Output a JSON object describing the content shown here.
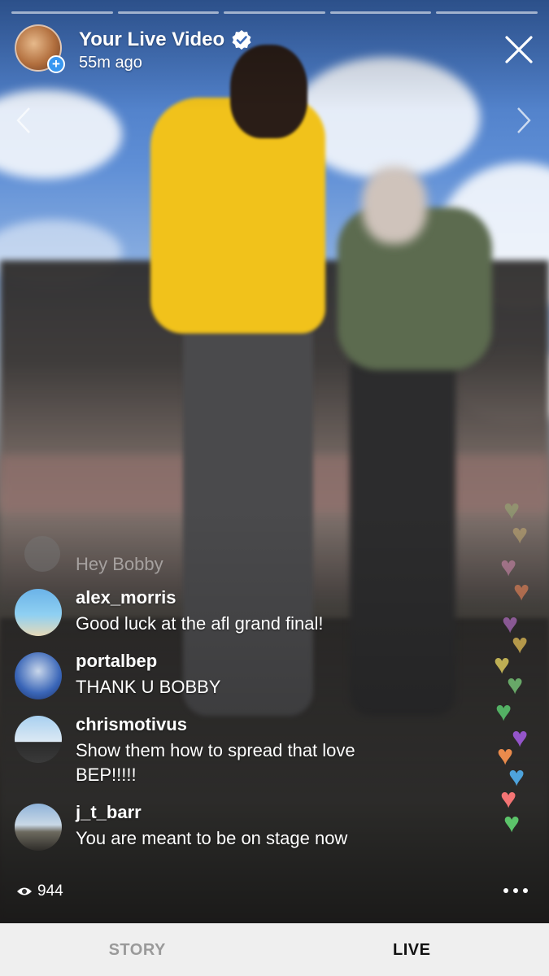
{
  "header": {
    "title": "Your Live Video",
    "subtitle": "55m ago",
    "verified_icon": "verified-badge-icon",
    "close_icon": "close-icon"
  },
  "progress_segments": 5,
  "comments": {
    "faded": {
      "message": "Hey Bobby"
    },
    "items": [
      {
        "username": "alex_morris",
        "message": "Good luck at the afl grand final!"
      },
      {
        "username": "portalbep",
        "message": "THANK U BOBBY"
      },
      {
        "username": "chrismotivus",
        "message": "Show them how to spread that love BEP!!!!!"
      },
      {
        "username": "j_t_barr",
        "message": "You are meant to be on stage now"
      }
    ]
  },
  "viewers": {
    "count": "944",
    "icon": "eye-icon"
  },
  "more_icon": "more-options-icon",
  "tabs": [
    {
      "label": "STORY",
      "active": false
    },
    {
      "label": "LIVE",
      "active": true
    }
  ],
  "colors": {
    "accent": "#3897f0",
    "tabbar_bg": "#efefef",
    "tab_inactive": "#9a9a9a",
    "tab_active": "#111111"
  }
}
